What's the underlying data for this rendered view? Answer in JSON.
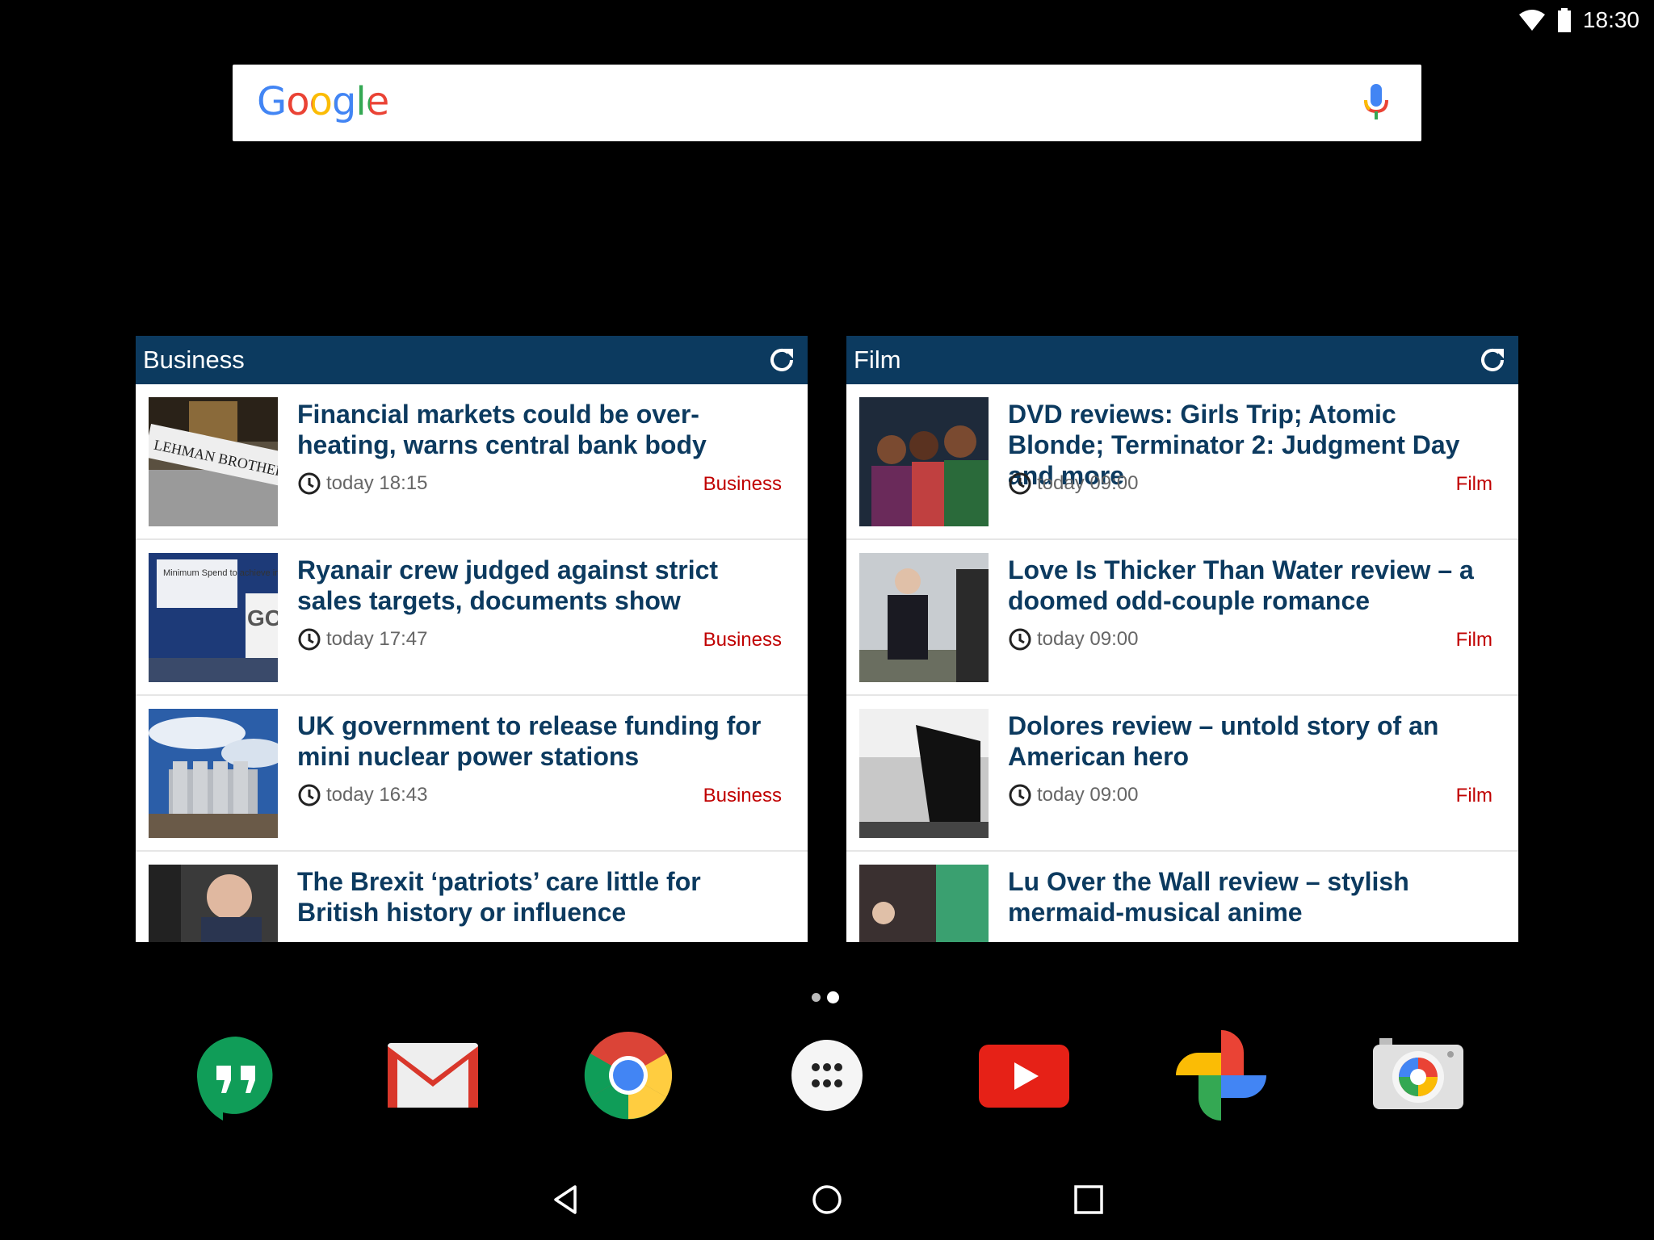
{
  "status_bar": {
    "time": "18:30",
    "wifi_icon": "wifi-icon",
    "battery_icon": "battery-icon"
  },
  "search": {
    "logo": "Google",
    "mic_icon": "microphone-icon"
  },
  "widgets": [
    {
      "title": "Business",
      "refresh_icon": "refresh-icon",
      "items": [
        {
          "headline": "Financial markets could be over-heating, warns central bank body",
          "time": "today 18:15",
          "category": "Business"
        },
        {
          "headline": "Ryanair crew judged against strict sales targets, documents show",
          "time": "today 17:47",
          "category": "Business"
        },
        {
          "headline": "UK government to release funding for mini nuclear power stations",
          "time": "today 16:43",
          "category": "Business"
        },
        {
          "headline": "The Brexit ‘patriots’ care little for British history or influence"
        }
      ]
    },
    {
      "title": "Film",
      "refresh_icon": "refresh-icon",
      "items": [
        {
          "headline": "DVD reviews: Girls Trip; Atomic Blonde; Terminator 2: Judgment Day and more",
          "time": "today 09:00",
          "category": "Film"
        },
        {
          "headline": "Love Is Thicker Than Water review – a doomed odd-couple romance",
          "time": "today 09:00",
          "category": "Film"
        },
        {
          "headline": "Dolores review – untold story of an American hero",
          "time": "today 09:00",
          "category": "Film"
        },
        {
          "headline": "Lu Over the Wall review – stylish mermaid-musical anime"
        }
      ]
    }
  ],
  "thumb_texts": {
    "lehman": "LEHMAN BROTHERS",
    "ryanair_sign": "Minimum Spend to achieve in your flights",
    "ryanair_logo": "GO"
  },
  "dock": [
    "Hangouts",
    "Gmail",
    "Chrome",
    "Apps",
    "YouTube",
    "Photos",
    "Camera"
  ],
  "nav": [
    "back",
    "home",
    "recents"
  ],
  "colors": {
    "header": "#0c3a5f",
    "headline": "#0c3a5f",
    "category": "#c00000"
  }
}
